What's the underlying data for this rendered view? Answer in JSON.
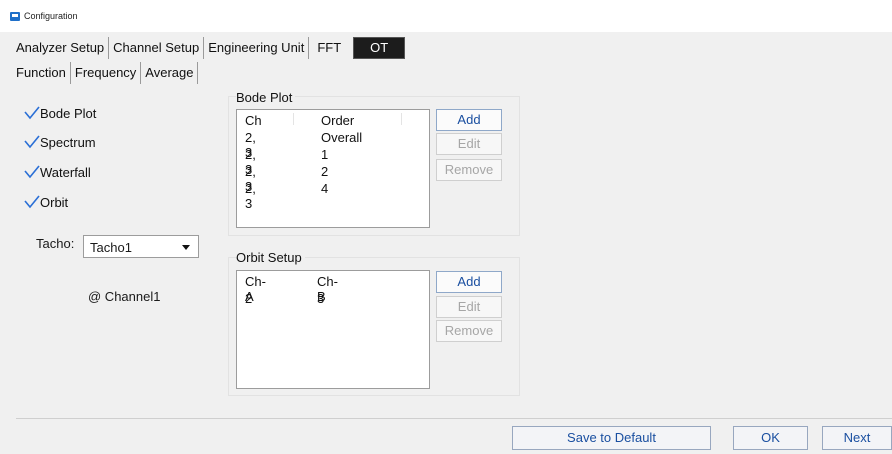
{
  "window": {
    "title": "Configuration"
  },
  "main_tabs": [
    {
      "label": "Analyzer Setup",
      "active": false
    },
    {
      "label": "Channel Setup",
      "active": false
    },
    {
      "label": "Engineering Unit",
      "active": false
    },
    {
      "label": "FFT",
      "active": false
    },
    {
      "label": "OT",
      "active": true
    }
  ],
  "sub_tabs": [
    {
      "label": "Function"
    },
    {
      "label": "Frequency"
    },
    {
      "label": "Average"
    }
  ],
  "functions": [
    {
      "label": "Bode Plot",
      "checked": true
    },
    {
      "label": "Spectrum",
      "checked": true
    },
    {
      "label": "Waterfall",
      "checked": true
    },
    {
      "label": "Orbit",
      "checked": true
    }
  ],
  "tacho": {
    "label": "Tacho:",
    "value": "Tacho1",
    "channel_note": "@ Channel1"
  },
  "bode_plot": {
    "title": "Bode Plot",
    "columns": [
      "Ch",
      "Order"
    ],
    "rows": [
      [
        "2, 3",
        "Overall"
      ],
      [
        "2, 3",
        "1"
      ],
      [
        "2, 3",
        "2"
      ],
      [
        "2, 3",
        "4"
      ]
    ],
    "buttons": {
      "add": "Add",
      "edit": "Edit",
      "remove": "Remove"
    }
  },
  "orbit_setup": {
    "title": "Orbit Setup",
    "columns": [
      "Ch-A",
      "Ch-B"
    ],
    "rows": [
      [
        "2",
        "3"
      ]
    ],
    "buttons": {
      "add": "Add",
      "edit": "Edit",
      "remove": "Remove"
    }
  },
  "footer": {
    "save_default": "Save to Default",
    "ok": "OK",
    "next": "Next"
  },
  "colors": {
    "accent": "#1a4fa0",
    "active_tab_bg": "#1c1c1c",
    "checkmark": "#2a6fd6",
    "disabled_text": "#a6a6a6"
  },
  "icons": {
    "app": "configuration-app-icon",
    "checkbox": "checkmark-icon",
    "dropdown": "chevron-down-icon"
  }
}
